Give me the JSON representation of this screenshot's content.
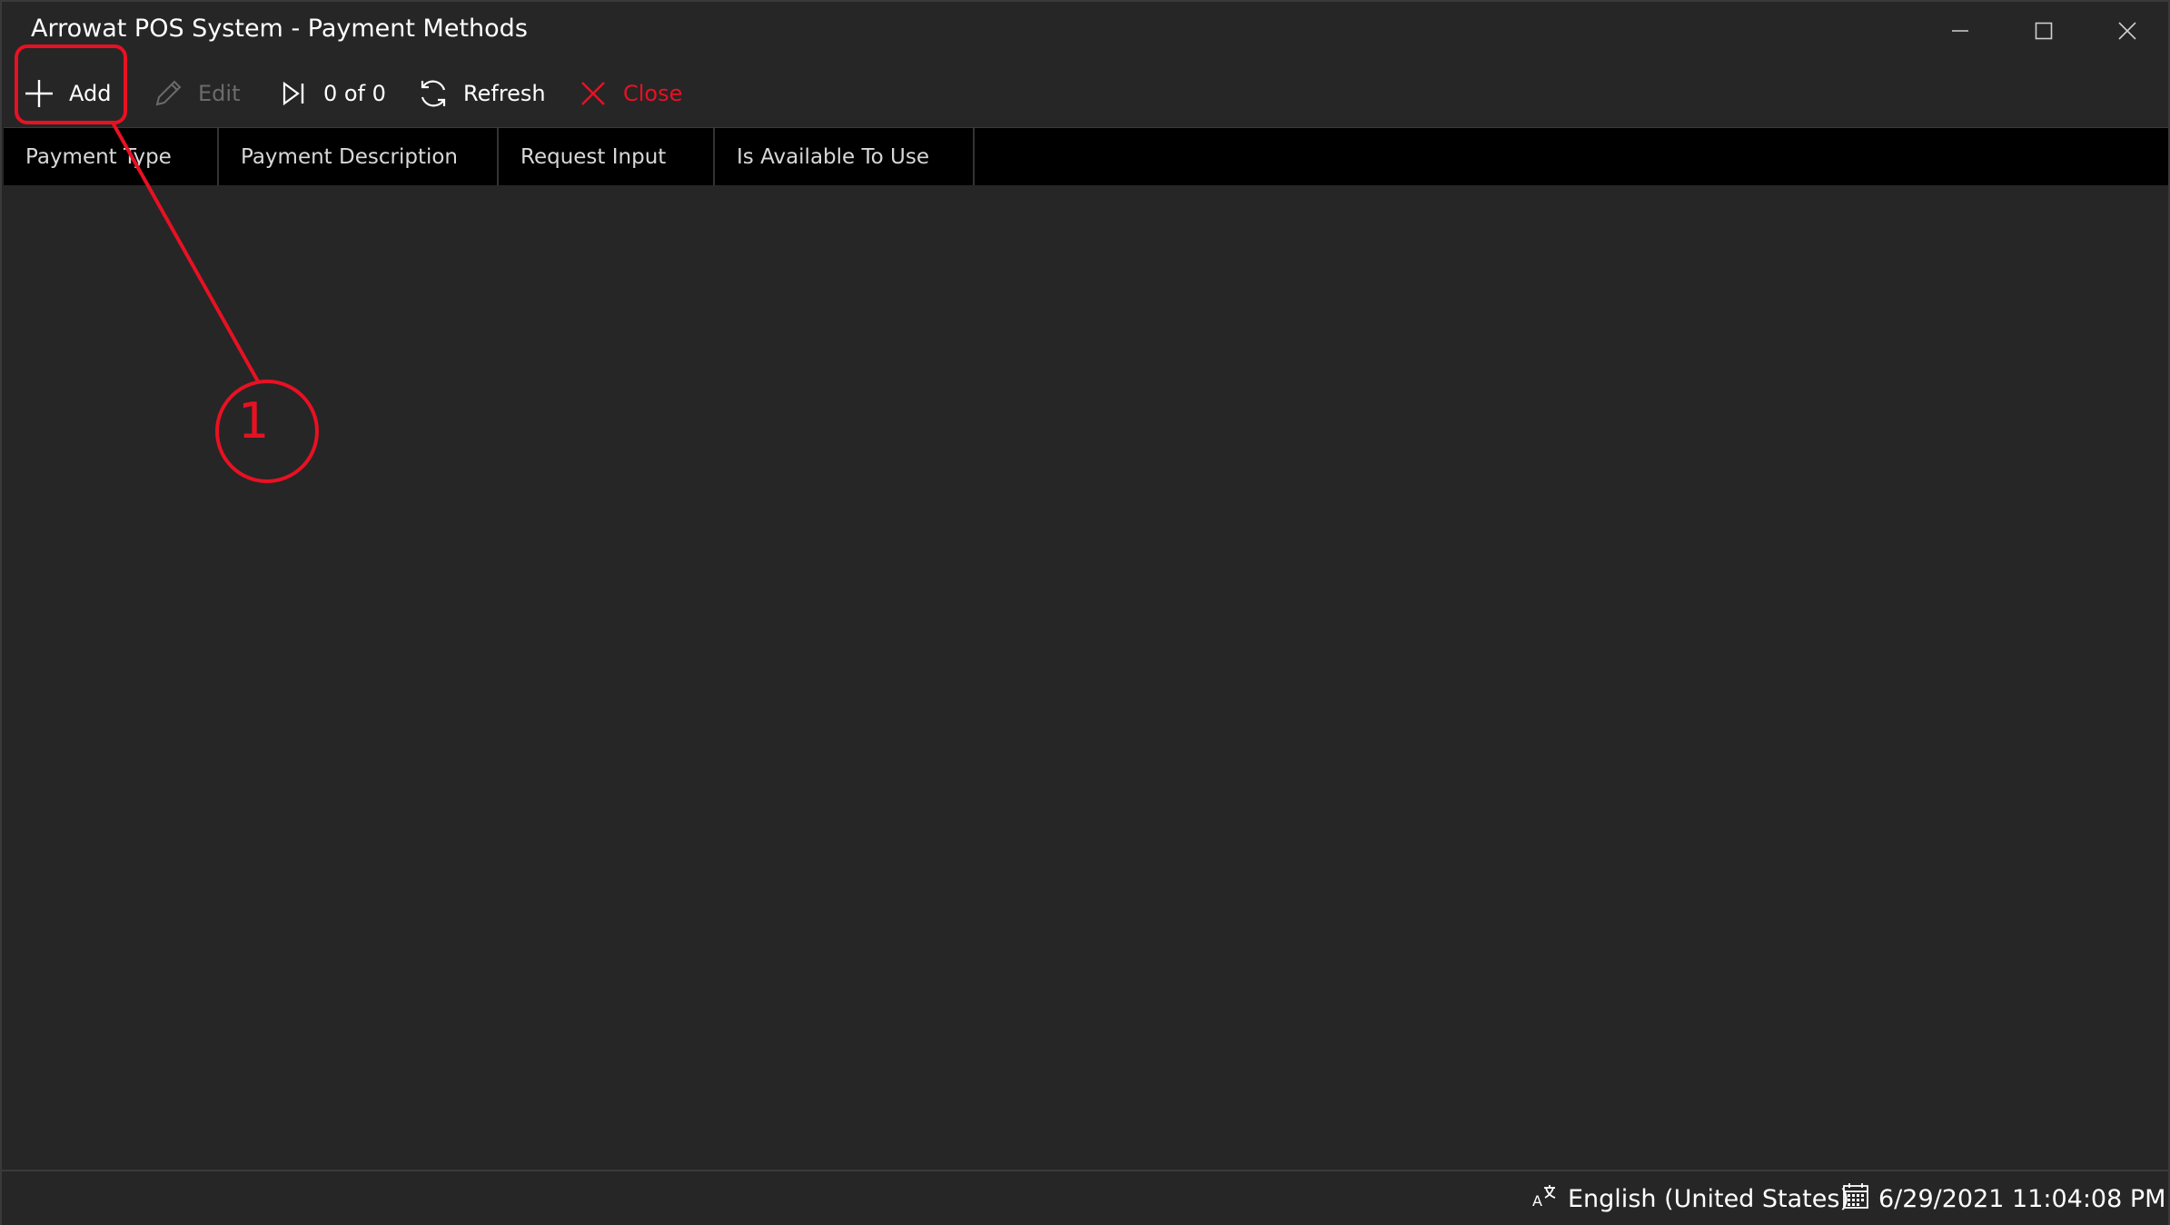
{
  "window": {
    "title": "Arrowat POS System - Payment Methods",
    "controls": [
      "minimize-icon",
      "maximize-icon",
      "close-icon"
    ]
  },
  "toolbar": {
    "add_label": "Add",
    "edit_label": "Edit",
    "record_position": "0 of 0",
    "refresh_label": "Refresh",
    "close_label": "Close"
  },
  "grid": {
    "columns": [
      "Payment Type",
      "Payment Description",
      "Request Input",
      "Is Available To Use"
    ],
    "rows": []
  },
  "statusbar": {
    "language": "English (United States)",
    "datetime": "6/29/2021 11:04:08 PM"
  },
  "annotation": {
    "callout_number": "1",
    "color": "#e81123"
  },
  "colors": {
    "background": "#262626",
    "header_background": "#000000",
    "accent_red": "#e81123",
    "disabled_text": "#6b6b6b"
  }
}
